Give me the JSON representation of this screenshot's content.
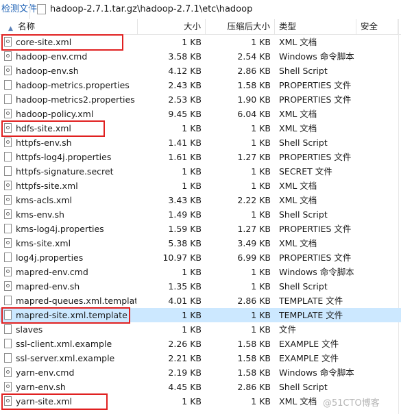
{
  "toolbar": {
    "left_label": "检测文件",
    "path": "hadoop-2.7.1.tar.gz\\hadoop-2.7.1\\etc\\hadoop",
    "icon": "folder-icon"
  },
  "columns": {
    "name": "名称",
    "size": "大小",
    "compressed": "压缩后大小",
    "type": "类型",
    "encrypted": "安全",
    "sort_icon": "sort-up-icon"
  },
  "files": [
    {
      "name": "core-site.xml",
      "size": "1 KB",
      "compressed": "1 KB",
      "type": "XML 文档",
      "icon": "document-icon",
      "highlighted": true
    },
    {
      "name": "hadoop-env.cmd",
      "size": "3.58 KB",
      "compressed": "2.54 KB",
      "type": "Windows 命令脚本",
      "icon": "script-icon"
    },
    {
      "name": "hadoop-env.sh",
      "size": "4.12 KB",
      "compressed": "2.86 KB",
      "type": "Shell Script",
      "icon": "script-icon"
    },
    {
      "name": "hadoop-metrics.properties",
      "size": "2.43 KB",
      "compressed": "1.58 KB",
      "type": "PROPERTIES 文件",
      "icon": "blank-file-icon"
    },
    {
      "name": "hadoop-metrics2.properties",
      "size": "2.53 KB",
      "compressed": "1.90 KB",
      "type": "PROPERTIES 文件",
      "icon": "blank-file-icon"
    },
    {
      "name": "hadoop-policy.xml",
      "size": "9.45 KB",
      "compressed": "6.04 KB",
      "type": "XML 文档",
      "icon": "document-icon"
    },
    {
      "name": "hdfs-site.xml",
      "size": "1 KB",
      "compressed": "1 KB",
      "type": "XML 文档",
      "icon": "document-icon",
      "highlighted": true
    },
    {
      "name": "httpfs-env.sh",
      "size": "1.41 KB",
      "compressed": "1 KB",
      "type": "Shell Script",
      "icon": "script-icon"
    },
    {
      "name": "httpfs-log4j.properties",
      "size": "1.61 KB",
      "compressed": "1.27 KB",
      "type": "PROPERTIES 文件",
      "icon": "blank-file-icon"
    },
    {
      "name": "httpfs-signature.secret",
      "size": "1 KB",
      "compressed": "1 KB",
      "type": "SECRET 文件",
      "icon": "blank-file-icon"
    },
    {
      "name": "httpfs-site.xml",
      "size": "1 KB",
      "compressed": "1 KB",
      "type": "XML 文档",
      "icon": "document-icon"
    },
    {
      "name": "kms-acls.xml",
      "size": "3.43 KB",
      "compressed": "2.22 KB",
      "type": "XML 文档",
      "icon": "document-icon"
    },
    {
      "name": "kms-env.sh",
      "size": "1.49 KB",
      "compressed": "1 KB",
      "type": "Shell Script",
      "icon": "script-icon"
    },
    {
      "name": "kms-log4j.properties",
      "size": "1.59 KB",
      "compressed": "1.27 KB",
      "type": "PROPERTIES 文件",
      "icon": "blank-file-icon"
    },
    {
      "name": "kms-site.xml",
      "size": "5.38 KB",
      "compressed": "3.49 KB",
      "type": "XML 文档",
      "icon": "document-icon"
    },
    {
      "name": "log4j.properties",
      "size": "10.97 KB",
      "compressed": "6.99 KB",
      "type": "PROPERTIES 文件",
      "icon": "blank-file-icon"
    },
    {
      "name": "mapred-env.cmd",
      "size": "1 KB",
      "compressed": "1 KB",
      "type": "Windows 命令脚本",
      "icon": "script-icon"
    },
    {
      "name": "mapred-env.sh",
      "size": "1.35 KB",
      "compressed": "1 KB",
      "type": "Shell Script",
      "icon": "script-icon"
    },
    {
      "name": "mapred-queues.xml.template",
      "size": "4.01 KB",
      "compressed": "2.86 KB",
      "type": "TEMPLATE 文件",
      "icon": "blank-file-icon"
    },
    {
      "name": "mapred-site.xml.template",
      "size": "1 KB",
      "compressed": "1 KB",
      "type": "TEMPLATE 文件",
      "icon": "blank-file-icon",
      "highlighted": true,
      "selected": true
    },
    {
      "name": "slaves",
      "size": "1 KB",
      "compressed": "1 KB",
      "type": "文件",
      "icon": "blank-file-icon"
    },
    {
      "name": "ssl-client.xml.example",
      "size": "2.26 KB",
      "compressed": "1.58 KB",
      "type": "EXAMPLE 文件",
      "icon": "blank-file-icon"
    },
    {
      "name": "ssl-server.xml.example",
      "size": "2.21 KB",
      "compressed": "1.58 KB",
      "type": "EXAMPLE 文件",
      "icon": "blank-file-icon"
    },
    {
      "name": "yarn-env.cmd",
      "size": "2.19 KB",
      "compressed": "1.58 KB",
      "type": "Windows 命令脚本",
      "icon": "script-icon"
    },
    {
      "name": "yarn-env.sh",
      "size": "4.45 KB",
      "compressed": "2.86 KB",
      "type": "Shell Script",
      "icon": "script-icon"
    },
    {
      "name": "yarn-site.xml",
      "size": "1 KB",
      "compressed": "1 KB",
      "type": "XML 文档",
      "icon": "document-icon",
      "highlighted": true
    }
  ],
  "colors": {
    "selection": "#cce8ff",
    "highlight_box": "#e02020",
    "link_blue": "#1a5fb4"
  },
  "watermark": "@51CTO博客"
}
